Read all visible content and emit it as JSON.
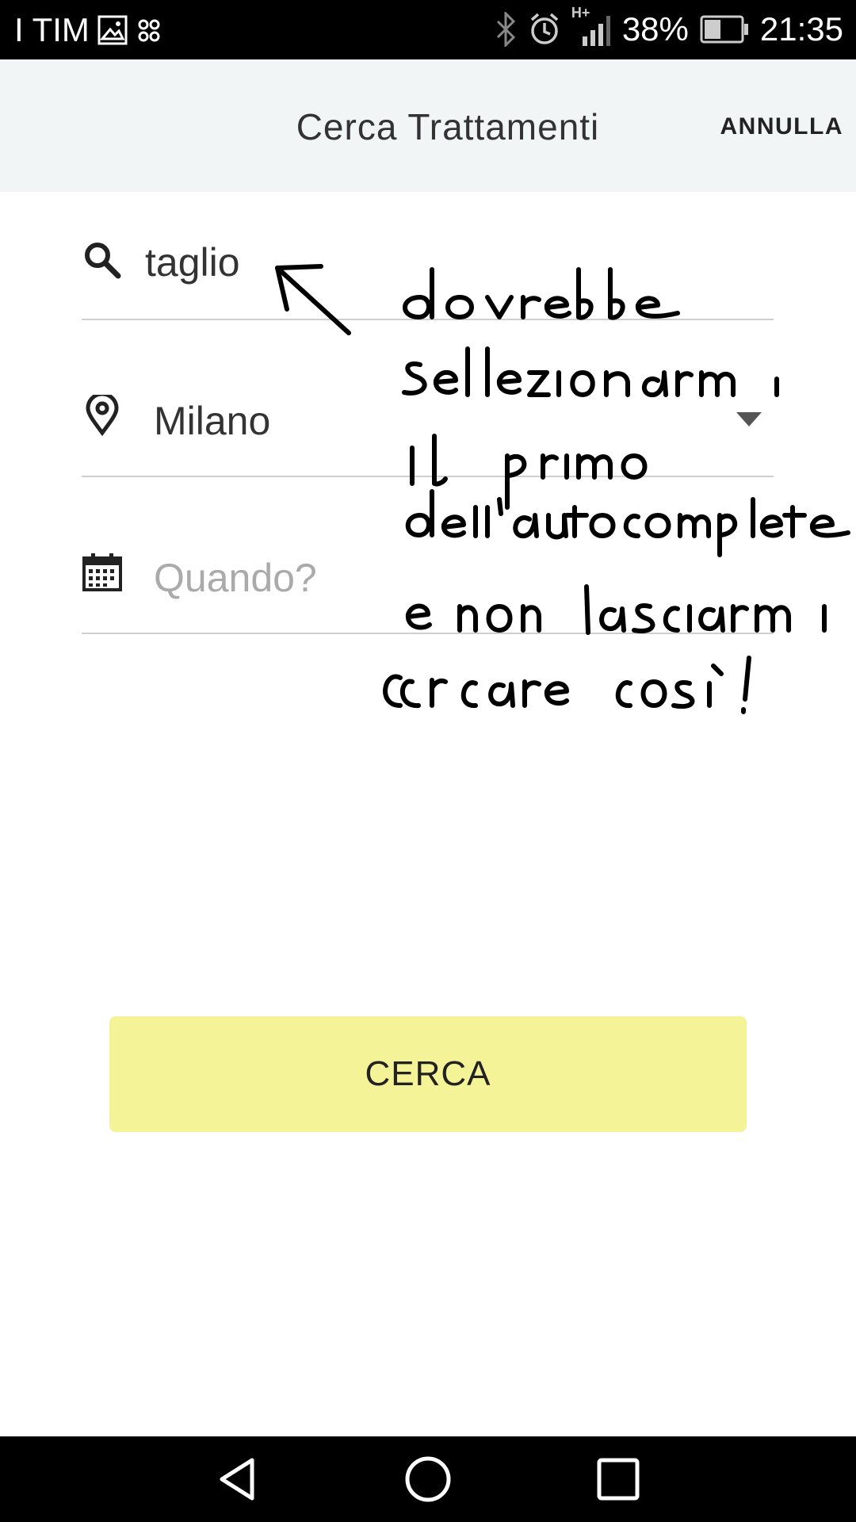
{
  "status_bar": {
    "carrier": "I TIM",
    "battery": "38%",
    "time": "21:35",
    "network": "H+",
    "icons": [
      "gallery-icon",
      "voicemail-icon",
      "bluetooth-icon",
      "alarm-icon",
      "signal-icon",
      "battery-icon"
    ]
  },
  "header": {
    "title": "Cerca Trattamenti",
    "cancel_label": "ANNULLA"
  },
  "form": {
    "search": {
      "value": "taglio",
      "icon": "search-icon"
    },
    "location": {
      "value": "Milano",
      "icon": "location-pin-icon"
    },
    "date": {
      "placeholder": "Quando?",
      "icon": "calendar-icon"
    }
  },
  "search_button": {
    "label": "CERCA",
    "color": "#f5f397"
  },
  "annotation": {
    "note": "dovrebbe selezionarmi il primo dell'autocomplete e non lasciarmi cercare così!"
  },
  "nav_bar": {
    "icons": [
      "back-icon",
      "home-icon",
      "recents-icon"
    ]
  }
}
